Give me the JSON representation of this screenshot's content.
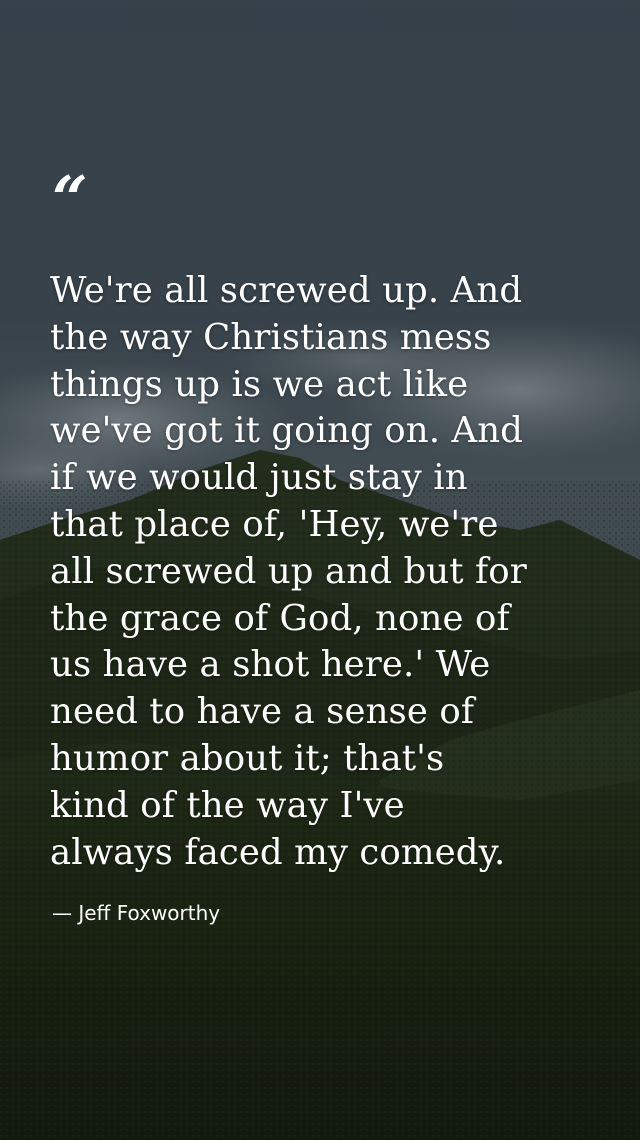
{
  "quote": {
    "open_mark": "“",
    "lines": [
      "We're all screwed up. And",
      "the way Christians mess",
      "things up is we act like",
      "we've got it going on. And",
      "if we would just stay in",
      "that place of, 'Hey, we're",
      "all screwed up and but for",
      "the grace of God, none of",
      "us have a shot here.' We",
      "need to have a sense of",
      "humor about it; that's",
      "kind of the way I've",
      "always faced my comedy."
    ],
    "author": "— Jeff Foxworthy"
  },
  "colors": {
    "sky_top": "#3f4c57",
    "sky_mid": "#4f5e69",
    "cloud": "#8e9aa0",
    "mountain": "#27321f",
    "grass": "#1f2a17",
    "text": "#ffffff"
  },
  "background": {
    "icon": "mountain-landscape-photo"
  }
}
